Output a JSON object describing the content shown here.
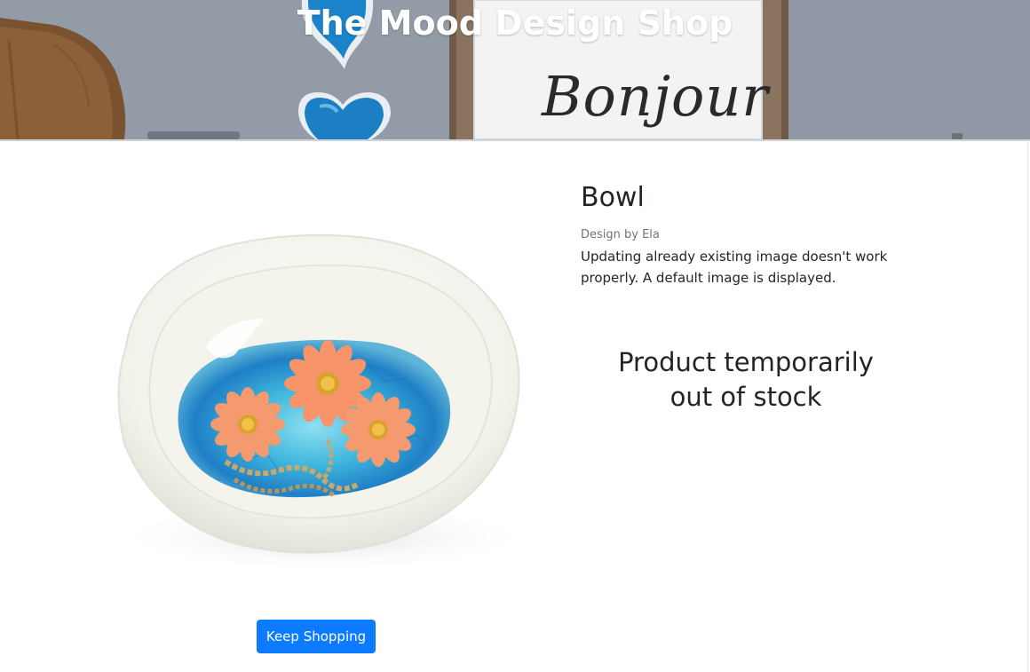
{
  "banner": {
    "title": "The Mood Design Shop",
    "sign_text": "Bonjour"
  },
  "product": {
    "name": "Bowl",
    "designer": "Design by Ela",
    "description": "Updating already existing image doesn't work properly. A default image is displayed.",
    "stock_status": "Product temporarily out of stock",
    "image_icon": "bowl-with-flower-jewelry"
  },
  "actions": {
    "keep_shopping_label": "Keep Shopping"
  },
  "colors": {
    "accent": "#0d7bff",
    "banner_text": "#ffffff",
    "muted_text": "#6c757d"
  }
}
